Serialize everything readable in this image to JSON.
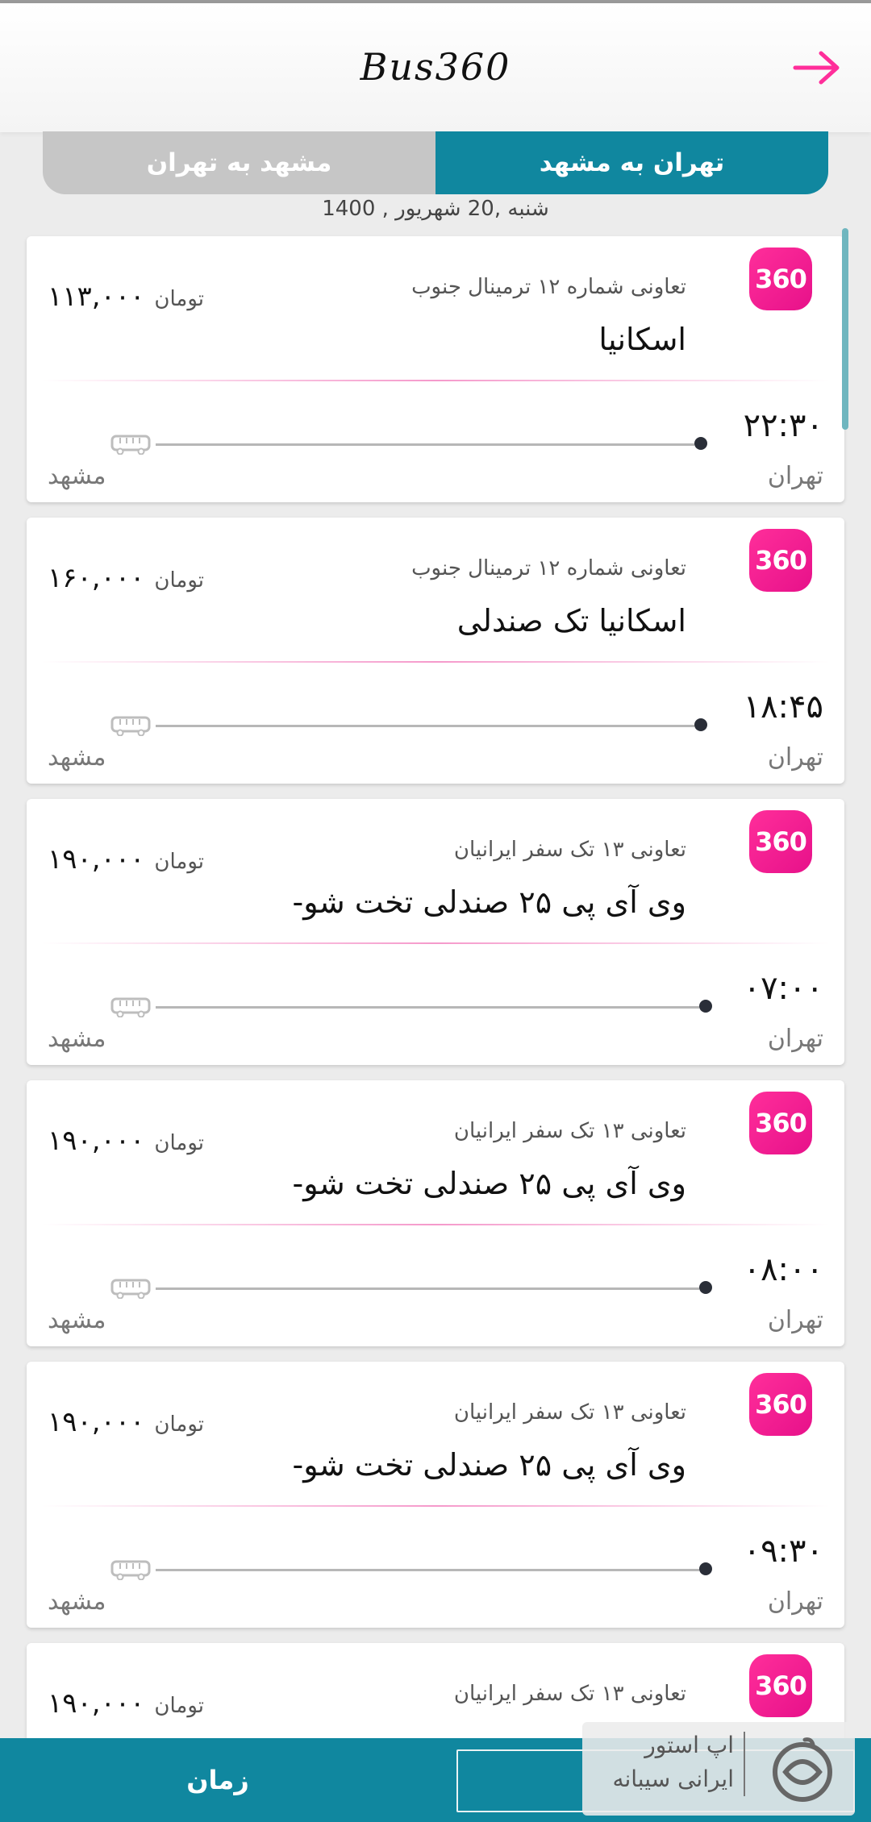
{
  "header": {
    "title": "Bus360",
    "back_icon": "arrow-right-icon",
    "accent_color": "#ff2e9a"
  },
  "tabs": [
    {
      "label": "مشهد به تهران",
      "active": false
    },
    {
      "label": "تهران به مشهد",
      "active": true
    }
  ],
  "date": "شنبه ,20 شهریور , 1400",
  "currency": "تومان",
  "brand_color": "#10879f",
  "trips": [
    {
      "badge": "360",
      "company": "تعاونی شماره ۱۲ ترمینال جنوب",
      "bus_type": "اسکانیا",
      "price": "۱۱۳,۰۰۰",
      "time": "۲۲:۳۰",
      "origin": "تهران",
      "destination": "مشهد"
    },
    {
      "badge": "360",
      "company": "تعاونی شماره ۱۲ ترمینال جنوب",
      "bus_type": "اسکانیا تک صندلی",
      "price": "۱۶۰,۰۰۰",
      "time": "۱۸:۴۵",
      "origin": "تهران",
      "destination": "مشهد"
    },
    {
      "badge": "360",
      "company": "تعاونی ۱۳ تک سفر ایرانیان",
      "bus_type": "وی آی پی ۲۵ صندلی تخت شو-",
      "price": "۱۹۰,۰۰۰",
      "time": "۰۷:۰۰",
      "origin": "تهران",
      "destination": "مشهد"
    },
    {
      "badge": "360",
      "company": "تعاونی ۱۳ تک سفر ایرانیان",
      "bus_type": "وی آی پی ۲۵ صندلی تخت شو-",
      "price": "۱۹۰,۰۰۰",
      "time": "۰۸:۰۰",
      "origin": "تهران",
      "destination": "مشهد"
    },
    {
      "badge": "360",
      "company": "تعاونی ۱۳ تک سفر ایرانیان",
      "bus_type": "وی آی پی ۲۵ صندلی تخت شو-",
      "price": "۱۹۰,۰۰۰",
      "time": "۰۹:۳۰",
      "origin": "تهران",
      "destination": "مشهد"
    },
    {
      "badge": "360",
      "company": "تعاونی ۱۳ تک سفر ایرانیان",
      "bus_type": "",
      "price": "۱۹۰,۰۰۰",
      "time": "",
      "origin": "",
      "destination": ""
    }
  ],
  "bottom_bar": {
    "sort_time_label": "زمان"
  },
  "store_banner": {
    "line1": "اپ استور",
    "line2": "ایرانی سیبانه"
  }
}
